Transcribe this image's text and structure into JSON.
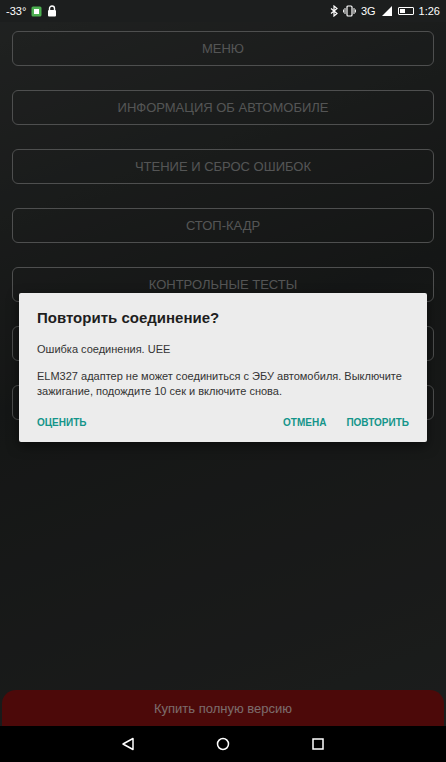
{
  "status_bar": {
    "temperature": "-33°",
    "network": "3G",
    "time": "1:26",
    "battery_level": 0.45
  },
  "menu": [
    {
      "label": "МЕНЮ"
    },
    {
      "label": "ИНФОРМАЦИЯ ОБ АВТОМОБИЛЕ"
    },
    {
      "label": "ЧТЕНИЕ И СБРОС ОШИБОК"
    },
    {
      "label": "СТОП-КАДР"
    },
    {
      "label": "КОНТРОЛЬНЫЕ ТЕСТЫ"
    },
    {
      "label": ""
    },
    {
      "label": ""
    }
  ],
  "dialog": {
    "title": "Повторить соединение?",
    "error": "Ошибка соединения. UEE",
    "message": "ELM327 адаптер не может соединиться с ЭБУ автомобиля. Выключите зажигание, подождите 10 сек и включите снова.",
    "left_button": "ОЦЕНИТЬ",
    "right_buttons": [
      "ОТМЕНА",
      "ПОВТОРИТЬ"
    ]
  },
  "buy_button": "Купить полную версию"
}
